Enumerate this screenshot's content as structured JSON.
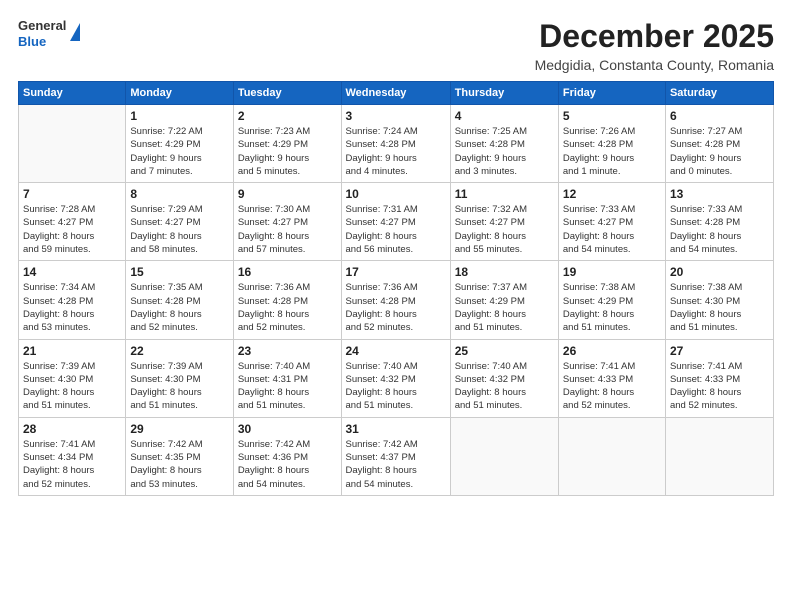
{
  "logo": {
    "general": "General",
    "blue": "Blue"
  },
  "title": {
    "month": "December 2025",
    "location": "Medgidia, Constanta County, Romania"
  },
  "headers": [
    "Sunday",
    "Monday",
    "Tuesday",
    "Wednesday",
    "Thursday",
    "Friday",
    "Saturday"
  ],
  "weeks": [
    [
      {
        "day": "",
        "info": ""
      },
      {
        "day": "1",
        "info": "Sunrise: 7:22 AM\nSunset: 4:29 PM\nDaylight: 9 hours\nand 7 minutes."
      },
      {
        "day": "2",
        "info": "Sunrise: 7:23 AM\nSunset: 4:29 PM\nDaylight: 9 hours\nand 5 minutes."
      },
      {
        "day": "3",
        "info": "Sunrise: 7:24 AM\nSunset: 4:28 PM\nDaylight: 9 hours\nand 4 minutes."
      },
      {
        "day": "4",
        "info": "Sunrise: 7:25 AM\nSunset: 4:28 PM\nDaylight: 9 hours\nand 3 minutes."
      },
      {
        "day": "5",
        "info": "Sunrise: 7:26 AM\nSunset: 4:28 PM\nDaylight: 9 hours\nand 1 minute."
      },
      {
        "day": "6",
        "info": "Sunrise: 7:27 AM\nSunset: 4:28 PM\nDaylight: 9 hours\nand 0 minutes."
      }
    ],
    [
      {
        "day": "7",
        "info": "Sunrise: 7:28 AM\nSunset: 4:27 PM\nDaylight: 8 hours\nand 59 minutes."
      },
      {
        "day": "8",
        "info": "Sunrise: 7:29 AM\nSunset: 4:27 PM\nDaylight: 8 hours\nand 58 minutes."
      },
      {
        "day": "9",
        "info": "Sunrise: 7:30 AM\nSunset: 4:27 PM\nDaylight: 8 hours\nand 57 minutes."
      },
      {
        "day": "10",
        "info": "Sunrise: 7:31 AM\nSunset: 4:27 PM\nDaylight: 8 hours\nand 56 minutes."
      },
      {
        "day": "11",
        "info": "Sunrise: 7:32 AM\nSunset: 4:27 PM\nDaylight: 8 hours\nand 55 minutes."
      },
      {
        "day": "12",
        "info": "Sunrise: 7:33 AM\nSunset: 4:27 PM\nDaylight: 8 hours\nand 54 minutes."
      },
      {
        "day": "13",
        "info": "Sunrise: 7:33 AM\nSunset: 4:28 PM\nDaylight: 8 hours\nand 54 minutes."
      }
    ],
    [
      {
        "day": "14",
        "info": "Sunrise: 7:34 AM\nSunset: 4:28 PM\nDaylight: 8 hours\nand 53 minutes."
      },
      {
        "day": "15",
        "info": "Sunrise: 7:35 AM\nSunset: 4:28 PM\nDaylight: 8 hours\nand 52 minutes."
      },
      {
        "day": "16",
        "info": "Sunrise: 7:36 AM\nSunset: 4:28 PM\nDaylight: 8 hours\nand 52 minutes."
      },
      {
        "day": "17",
        "info": "Sunrise: 7:36 AM\nSunset: 4:28 PM\nDaylight: 8 hours\nand 52 minutes."
      },
      {
        "day": "18",
        "info": "Sunrise: 7:37 AM\nSunset: 4:29 PM\nDaylight: 8 hours\nand 51 minutes."
      },
      {
        "day": "19",
        "info": "Sunrise: 7:38 AM\nSunset: 4:29 PM\nDaylight: 8 hours\nand 51 minutes."
      },
      {
        "day": "20",
        "info": "Sunrise: 7:38 AM\nSunset: 4:30 PM\nDaylight: 8 hours\nand 51 minutes."
      }
    ],
    [
      {
        "day": "21",
        "info": "Sunrise: 7:39 AM\nSunset: 4:30 PM\nDaylight: 8 hours\nand 51 minutes."
      },
      {
        "day": "22",
        "info": "Sunrise: 7:39 AM\nSunset: 4:30 PM\nDaylight: 8 hours\nand 51 minutes."
      },
      {
        "day": "23",
        "info": "Sunrise: 7:40 AM\nSunset: 4:31 PM\nDaylight: 8 hours\nand 51 minutes."
      },
      {
        "day": "24",
        "info": "Sunrise: 7:40 AM\nSunset: 4:32 PM\nDaylight: 8 hours\nand 51 minutes."
      },
      {
        "day": "25",
        "info": "Sunrise: 7:40 AM\nSunset: 4:32 PM\nDaylight: 8 hours\nand 51 minutes."
      },
      {
        "day": "26",
        "info": "Sunrise: 7:41 AM\nSunset: 4:33 PM\nDaylight: 8 hours\nand 52 minutes."
      },
      {
        "day": "27",
        "info": "Sunrise: 7:41 AM\nSunset: 4:33 PM\nDaylight: 8 hours\nand 52 minutes."
      }
    ],
    [
      {
        "day": "28",
        "info": "Sunrise: 7:41 AM\nSunset: 4:34 PM\nDaylight: 8 hours\nand 52 minutes."
      },
      {
        "day": "29",
        "info": "Sunrise: 7:42 AM\nSunset: 4:35 PM\nDaylight: 8 hours\nand 53 minutes."
      },
      {
        "day": "30",
        "info": "Sunrise: 7:42 AM\nSunset: 4:36 PM\nDaylight: 8 hours\nand 54 minutes."
      },
      {
        "day": "31",
        "info": "Sunrise: 7:42 AM\nSunset: 4:37 PM\nDaylight: 8 hours\nand 54 minutes."
      },
      {
        "day": "",
        "info": ""
      },
      {
        "day": "",
        "info": ""
      },
      {
        "day": "",
        "info": ""
      }
    ]
  ]
}
